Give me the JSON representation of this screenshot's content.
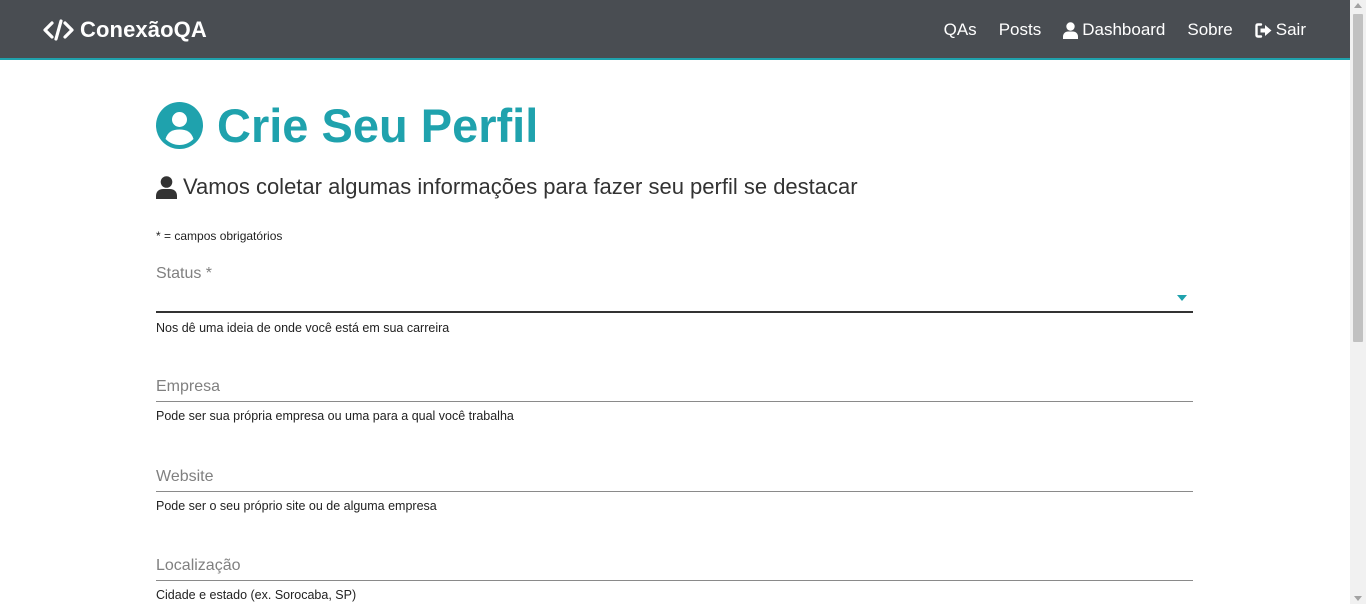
{
  "navbar": {
    "brand": "ConexãoQA",
    "links": [
      {
        "label": "QAs",
        "icon": ""
      },
      {
        "label": "Posts",
        "icon": ""
      },
      {
        "label": "Dashboard",
        "icon": "user-icon"
      },
      {
        "label": "Sobre",
        "icon": ""
      },
      {
        "label": "Sair",
        "icon": "sign-out-icon"
      }
    ]
  },
  "page": {
    "title": "Crie Seu Perfil",
    "lead": "Vamos coletar algumas informações para fazer seu perfil se destacar",
    "required_note": "* = campos obrigatórios"
  },
  "form": {
    "status": {
      "label": "Status *",
      "value": "",
      "help": "Nos dê uma ideia de onde você está em sua carreira"
    },
    "empresa": {
      "label": "Empresa",
      "value": "",
      "help": "Pode ser sua própria empresa ou uma para a qual você trabalha"
    },
    "website": {
      "label": "Website",
      "value": "",
      "help": "Pode ser o seu próprio site ou de alguma empresa"
    },
    "localizacao": {
      "label": "Localização",
      "value": "",
      "help": "Cidade e estado (ex. Sorocaba, SP)"
    }
  },
  "colors": {
    "accent": "#1fa2ad",
    "navbar": "#494d52"
  }
}
